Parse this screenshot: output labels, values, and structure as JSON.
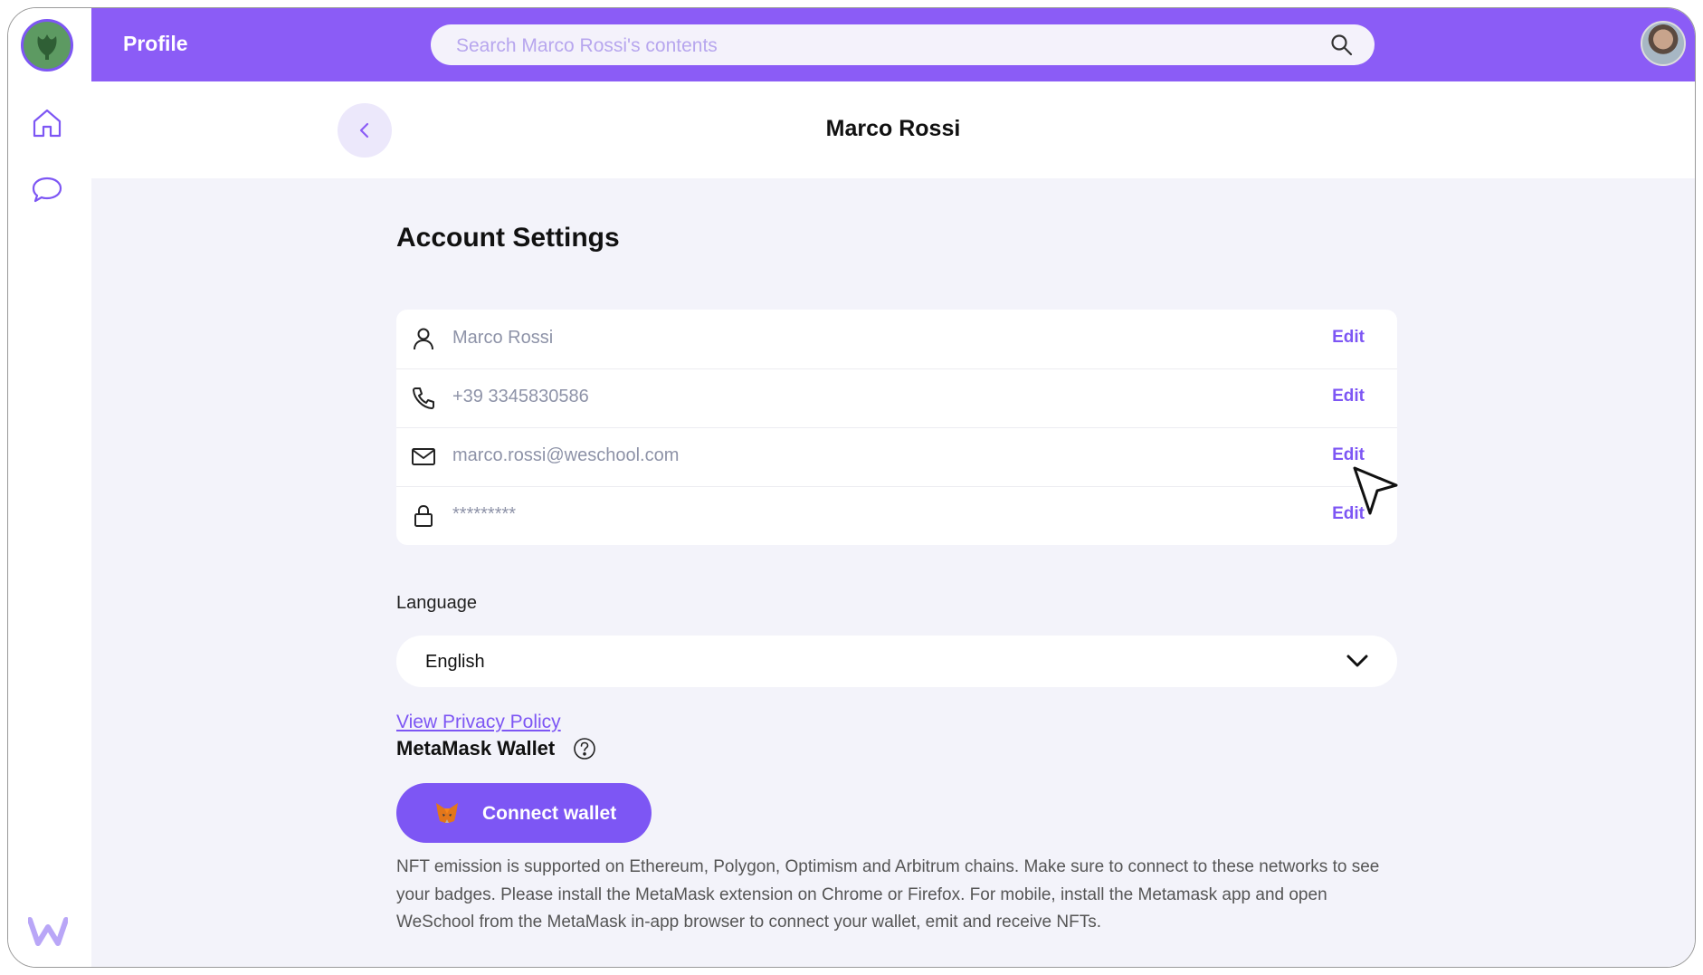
{
  "topbar": {
    "title": "Profile",
    "search_placeholder": "Search Marco Rossi's contents"
  },
  "sidebar": {
    "items": [
      {
        "icon": "home-icon"
      },
      {
        "icon": "chat-icon"
      }
    ],
    "brand_icon": "weschool-logo-icon"
  },
  "header": {
    "name": "Marco Rossi"
  },
  "settings": {
    "title": "Account Settings",
    "rows": [
      {
        "icon": "user-icon",
        "value": "Marco Rossi",
        "action": "Edit"
      },
      {
        "icon": "phone-icon",
        "value": "+39 3345830586",
        "action": "Edit"
      },
      {
        "icon": "mail-icon",
        "value": "marco.rossi@weschool.com",
        "action": "Edit"
      },
      {
        "icon": "lock-icon",
        "value": "*********",
        "action": "Edit"
      }
    ],
    "language_label": "Language",
    "language_value": "English",
    "privacy_link": "View Privacy Policy",
    "wallet_title": "MetaMask Wallet",
    "connect_label": "Connect wallet",
    "note": "NFT emission is supported on Ethereum, Polygon, Optimism and Arbitrum chains. Make sure to connect to these networks to see your badges. Please install the MetaMask extension on Chrome or Firefox. For mobile, install the Metamask app and open WeSchool from the MetaMask in-app browser to connect your wallet, emit and receive NFTs."
  },
  "colors": {
    "accent": "#8b5cf6",
    "button": "#7d56f4",
    "page_bg": "#f3f3fa"
  }
}
